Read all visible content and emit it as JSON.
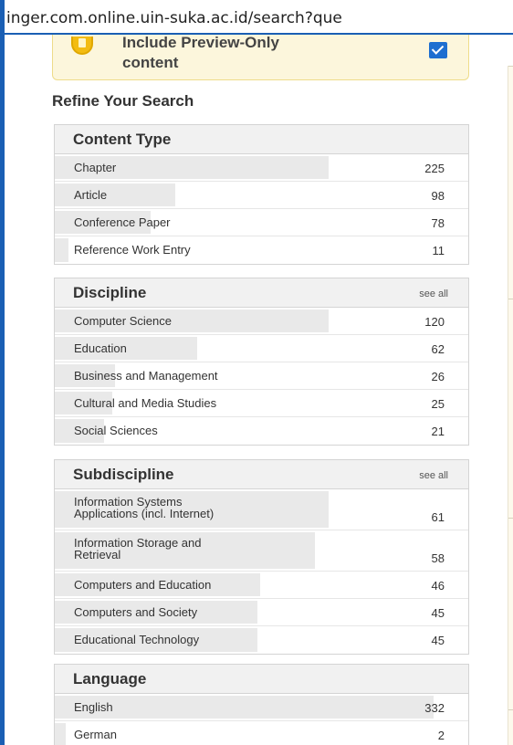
{
  "browser": {
    "url": "inger.com.online.uin-suka.ac.id/search?que"
  },
  "preview": {
    "line1": "Include Preview-Only",
    "line2": "content",
    "checked": true
  },
  "refine": {
    "title": "Refine Your Search"
  },
  "facets": {
    "content_type": {
      "title": "Content Type",
      "items": [
        {
          "label": "Chapter",
          "count": "225",
          "share": 1.0
        },
        {
          "label": "Article",
          "count": "98",
          "share": 0.44
        },
        {
          "label": "Conference Paper",
          "count": "78",
          "share": 0.35
        },
        {
          "label": "Reference Work Entry",
          "count": "11",
          "share": 0.05
        }
      ]
    },
    "discipline": {
      "title": "Discipline",
      "see_all": "see all",
      "items": [
        {
          "label": "Computer Science",
          "count": "120",
          "share": 1.0
        },
        {
          "label": "Education",
          "count": "62",
          "share": 0.52
        },
        {
          "label": "Business and Management",
          "count": "26",
          "share": 0.22
        },
        {
          "label": "Cultural and Media Studies",
          "count": "25",
          "share": 0.21
        },
        {
          "label": "Social Sciences",
          "count": "21",
          "share": 0.18
        }
      ]
    },
    "subdiscipline": {
      "title": "Subdiscipline",
      "see_all": "see all",
      "items": [
        {
          "label_line1": "Information Systems",
          "label_line2": "Applications (incl. Internet)",
          "count": "61",
          "share": 1.0
        },
        {
          "label_line1": "Information Storage and",
          "label_line2": "Retrieval",
          "count": "58",
          "share": 0.95
        },
        {
          "label": "Computers and Education",
          "count": "46",
          "share": 0.75
        },
        {
          "label": "Computers and Society",
          "count": "45",
          "share": 0.74
        },
        {
          "label": "Educational Technology",
          "count": "45",
          "share": 0.74
        }
      ]
    },
    "language": {
      "title": "Language",
      "items": [
        {
          "label": "English",
          "count": "332",
          "share": 1.0
        },
        {
          "label": "German",
          "count": "2",
          "share": 0.01
        }
      ]
    }
  }
}
